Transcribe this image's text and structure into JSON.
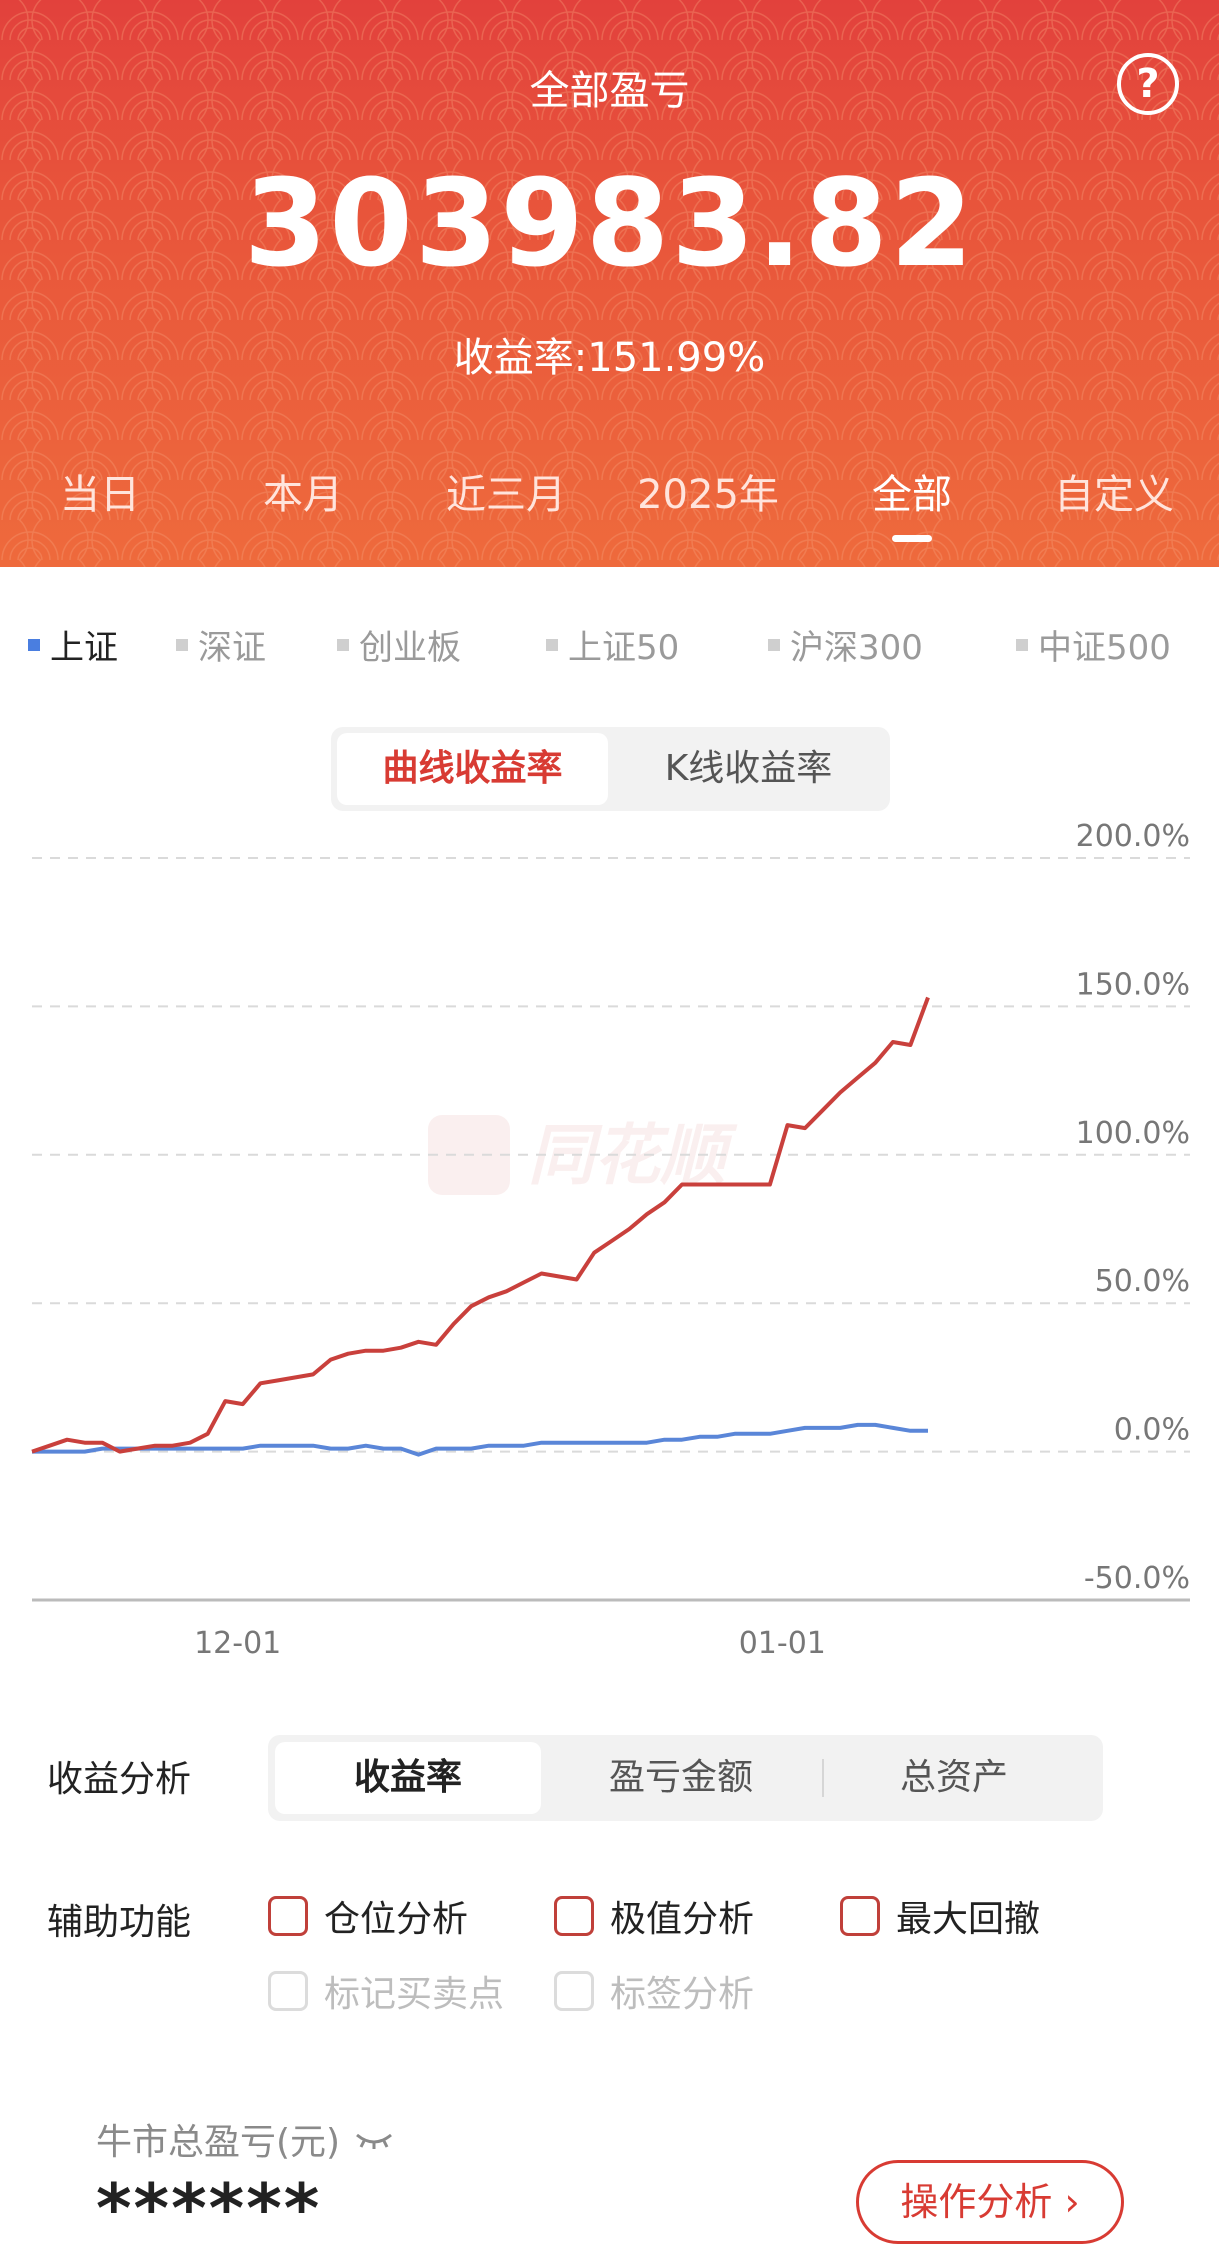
{
  "header": {
    "title": "全部盈亏",
    "help_icon": "?",
    "total_profit": "303983.82",
    "return_rate": "收益率:151.99%",
    "tabs": [
      {
        "label": "当日"
      },
      {
        "label": "本月"
      },
      {
        "label": "近三月"
      },
      {
        "label": "2025年"
      },
      {
        "label": "全部",
        "active": true
      },
      {
        "label": "自定义"
      }
    ]
  },
  "indices": [
    {
      "label": "上证",
      "active": true
    },
    {
      "label": "深证"
    },
    {
      "label": "创业板"
    },
    {
      "label": "上证50"
    },
    {
      "label": "沪深300"
    },
    {
      "label": "中证500"
    }
  ],
  "chart_mode": {
    "options": [
      {
        "label": "曲线收益率",
        "active": true
      },
      {
        "label": "K线收益率"
      }
    ]
  },
  "watermark": "同花顺",
  "chart_data": {
    "type": "line",
    "ylim": [
      -50,
      200
    ],
    "yticks": [
      "200.0%",
      "150.0%",
      "100.0%",
      "50.0%",
      "0.0%",
      "-50.0%"
    ],
    "xticks": [
      {
        "label": "12-01",
        "index": 10
      },
      {
        "label": "01-01",
        "index": 41
      }
    ],
    "colors": {
      "portfolio": "#c9403c",
      "index": "#5a86d8"
    },
    "series": [
      {
        "key": "portfolio",
        "values": [
          0,
          2,
          4,
          3,
          3,
          0,
          1,
          2,
          2,
          3,
          6,
          17,
          16,
          23,
          24,
          25,
          26,
          31,
          33,
          34,
          34,
          35,
          37,
          36,
          43,
          49,
          52,
          54,
          57,
          60,
          59,
          58,
          67,
          71,
          75,
          80,
          84,
          90,
          90,
          90,
          90,
          90,
          90,
          110,
          109,
          115,
          121,
          126,
          131,
          138,
          137,
          153
        ]
      },
      {
        "key": "index",
        "values": [
          0,
          0,
          0,
          0,
          1,
          1,
          1,
          1,
          1,
          1,
          1,
          1,
          1,
          2,
          2,
          2,
          2,
          1,
          1,
          2,
          1,
          1,
          -1,
          1,
          1,
          1,
          2,
          2,
          2,
          3,
          3,
          3,
          3,
          3,
          3,
          3,
          4,
          4,
          5,
          5,
          6,
          6,
          6,
          7,
          8,
          8,
          8,
          9,
          9,
          8,
          7,
          7
        ]
      }
    ]
  },
  "analysis": {
    "label": "收益分析",
    "options": [
      {
        "label": "收益率",
        "active": true
      },
      {
        "label": "盈亏金额"
      },
      {
        "label": "总资产"
      }
    ]
  },
  "aux": {
    "label": "辅助功能",
    "options": [
      {
        "label": "仓位分析",
        "enabled": true
      },
      {
        "label": "极值分析",
        "enabled": true
      },
      {
        "label": "最大回撤",
        "enabled": true
      },
      {
        "label": "标记买卖点",
        "enabled": false
      },
      {
        "label": "标签分析",
        "enabled": false
      }
    ]
  },
  "bull": {
    "label": "牛市总盈亏(元)",
    "value": "******",
    "button": "操作分析 ›"
  }
}
